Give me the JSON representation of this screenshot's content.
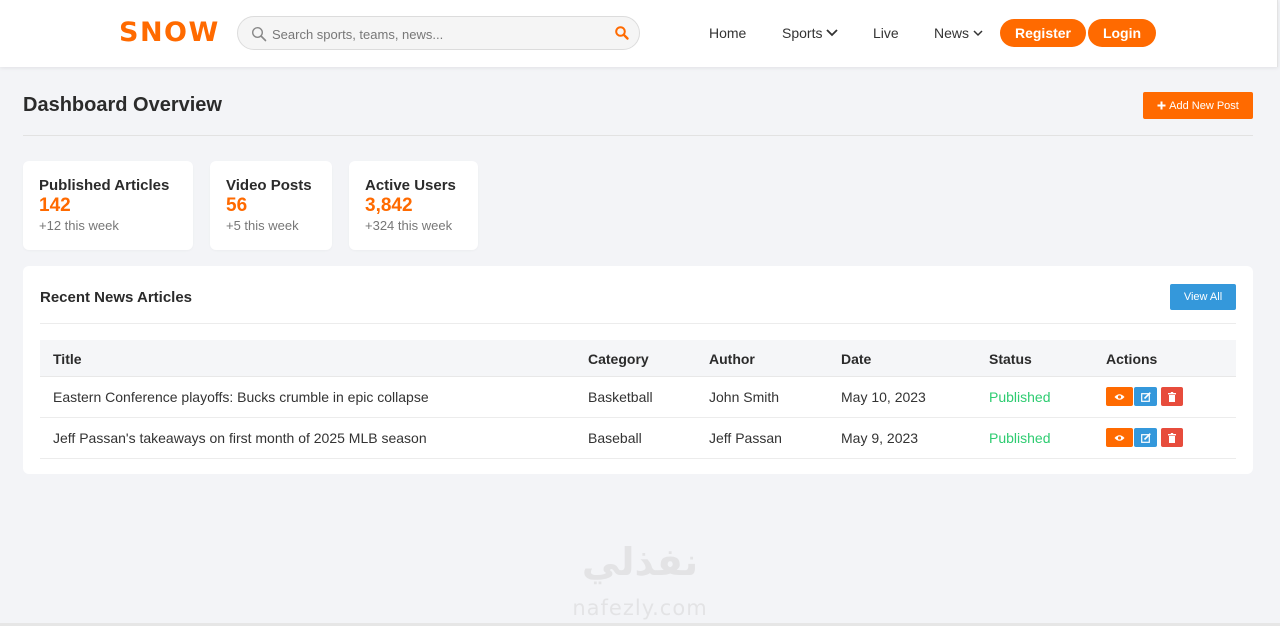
{
  "header": {
    "logo": "SNOW",
    "search_placeholder": "Search sports, teams, news...",
    "nav": {
      "home": "Home",
      "sports": "Sports",
      "live": "Live",
      "news": "News"
    },
    "register": "Register",
    "login": "Login"
  },
  "page": {
    "title": "Dashboard Overview",
    "add_post": "Add New Post"
  },
  "stats": [
    {
      "title": "Published Articles",
      "value": "142",
      "delta": "+12 this week"
    },
    {
      "title": "Video Posts",
      "value": "56",
      "delta": "+5 this week"
    },
    {
      "title": "Active Users",
      "value": "3,842",
      "delta": "+324 this week"
    }
  ],
  "recent": {
    "title": "Recent News Articles",
    "view_all": "View All",
    "columns": {
      "title": "Title",
      "category": "Category",
      "author": "Author",
      "date": "Date",
      "status": "Status",
      "actions": "Actions"
    },
    "rows": [
      {
        "title": "Eastern Conference playoffs: Bucks crumble in epic collapse",
        "category": "Basketball",
        "author": "John Smith",
        "date": "May 10, 2023",
        "status": "Published"
      },
      {
        "title": "Jeff Passan's takeaways on first month of 2025 MLB season",
        "category": "Baseball",
        "author": "Jeff Passan",
        "date": "May 9, 2023",
        "status": "Published"
      }
    ]
  },
  "watermark": {
    "arabic": "نفذلي",
    "latin": "nafezly.com"
  },
  "colors": {
    "accent": "#ff6a00",
    "info": "#3498db",
    "danger": "#e74c3c",
    "success": "#2ecc71",
    "background": "#f3f4f7"
  },
  "icons": {
    "search": "search-icon",
    "chevron": "chevron-down-icon",
    "plus": "plus-icon",
    "view": "eye-icon",
    "edit": "edit-icon",
    "delete": "trash-icon"
  }
}
